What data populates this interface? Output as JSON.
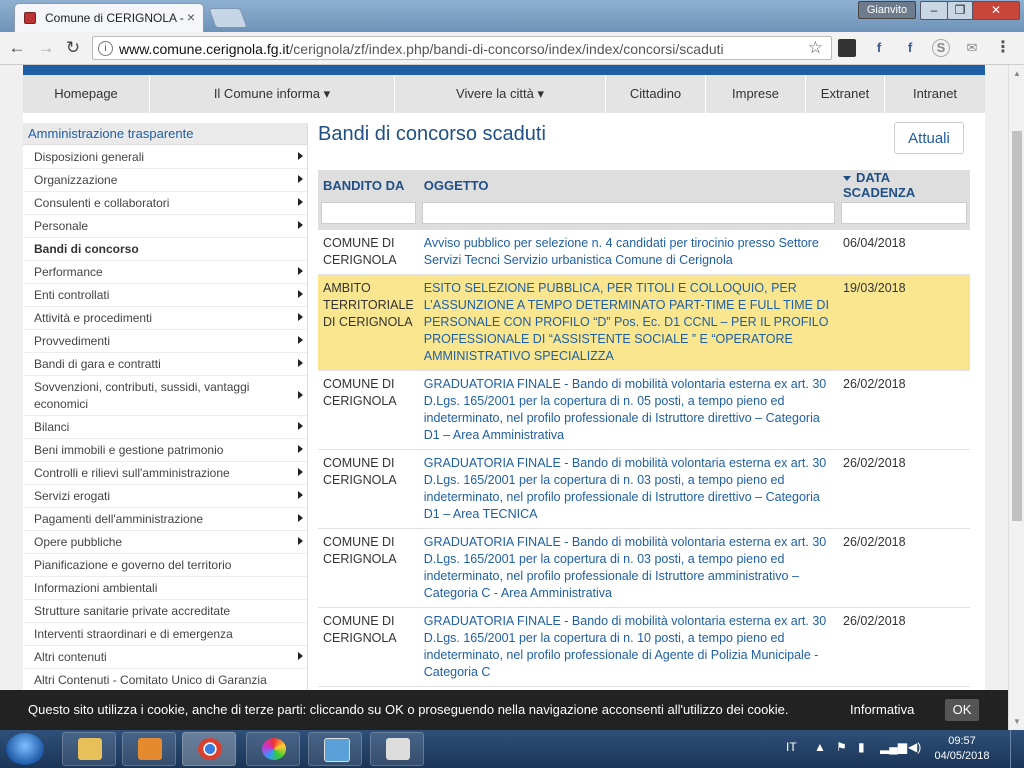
{
  "browser": {
    "tab_title": "Comune di CERIGNOLA -",
    "tab_close": "×",
    "user": "Gianvito",
    "url_host": "www.comune.cerignola.fg.it",
    "url_path": "/cerignola/zf/index.php/bandi-di-concorso/index/index/concorsi/scaduti",
    "back": "←",
    "forward": "→",
    "reload": "↻",
    "star": "☆",
    "win_min": "–",
    "win_max": "❐",
    "win_close": "✕",
    "ext_fb1": "f",
    "ext_fb2": "f",
    "ext_skype": "S"
  },
  "nav": [
    "Homepage",
    "Il Comune informa ▾",
    "Vivere la città ▾",
    "Cittadino",
    "Imprese",
    "Extranet",
    "Intranet"
  ],
  "sidebar": {
    "title": "Amministrazione trasparente",
    "items": [
      {
        "label": "Disposizioni generali",
        "arrow": true
      },
      {
        "label": "Organizzazione",
        "arrow": true
      },
      {
        "label": "Consulenti e collaboratori",
        "arrow": true
      },
      {
        "label": "Personale",
        "arrow": true
      },
      {
        "label": "Bandi di concorso",
        "arrow": false,
        "active": true
      },
      {
        "label": "Performance",
        "arrow": true
      },
      {
        "label": "Enti controllati",
        "arrow": true
      },
      {
        "label": "Attività e procedimenti",
        "arrow": true
      },
      {
        "label": "Provvedimenti",
        "arrow": true
      },
      {
        "label": "Bandi di gara e contratti",
        "arrow": true
      },
      {
        "label": "Sovvenzioni, contributi, sussidi, vantaggi economici",
        "arrow": true
      },
      {
        "label": "Bilanci",
        "arrow": true
      },
      {
        "label": "Beni immobili e gestione patrimonio",
        "arrow": true
      },
      {
        "label": "Controlli e rilievi sull'amministrazione",
        "arrow": true
      },
      {
        "label": "Servizi erogati",
        "arrow": true
      },
      {
        "label": "Pagamenti dell'amministrazione",
        "arrow": true
      },
      {
        "label": "Opere pubbliche",
        "arrow": true
      },
      {
        "label": "Pianificazione e governo del territorio",
        "arrow": false
      },
      {
        "label": "Informazioni ambientali",
        "arrow": false
      },
      {
        "label": "Strutture sanitarie private accreditate",
        "arrow": false
      },
      {
        "label": "Interventi straordinari e di emergenza",
        "arrow": false
      },
      {
        "label": "Altri contenuti",
        "arrow": true
      },
      {
        "label": "Altri Contenuti - Comitato Unico di Garanzia",
        "arrow": false
      }
    ]
  },
  "main": {
    "title": "Bandi di concorso scaduti",
    "attuali_button": "Attuali",
    "columns": {
      "bandito_da": "BANDITO DA",
      "oggetto": "OGGETTO",
      "data": "DATA SCADENZA"
    },
    "rows": [
      {
        "ente": "COMUNE DI CERIGNOLA",
        "oggetto": "Avviso pubblico per selezione n. 4 candidati per tirocinio presso Settore Servizi Tecnci Servizio urbanistica Comune di Cerignola",
        "data": "06/04/2018",
        "highlight": false
      },
      {
        "ente": "AMBITO TERRITORIALE DI CERIGNOLA",
        "oggetto": "ESITO SELEZIONE PUBBLICA, PER TITOLI E COLLOQUIO, PER L’ASSUNZIONE A TEMPO DETERMINATO PART-TIME E FULL TIME DI PERSONALE CON PROFILO “D” Pos. Ec. D1 CCNL – PER IL PROFILO PROFESSIONALE DI “ASSISTENTE SOCIALE ” E “OPERATORE AMMINISTRATIVO SPECIALIZZA",
        "data": "19/03/2018",
        "highlight": true
      },
      {
        "ente": "COMUNE DI CERIGNOLA",
        "oggetto": "GRADUATORIA FINALE - Bando di mobilità volontaria esterna ex art. 30 D.Lgs. 165/2001 per la copertura di n. 05 posti, a tempo pieno ed indeterminato, nel profilo professionale di Istruttore direttivo – Categoria D1 – Area Amministrativa",
        "data": "26/02/2018",
        "highlight": false
      },
      {
        "ente": "COMUNE DI CERIGNOLA",
        "oggetto": "GRADUATORIA FINALE - Bando di mobilità volontaria esterna ex art. 30 D.Lgs. 165/2001 per la copertura di n. 03 posti, a tempo pieno ed indeterminato, nel profilo professionale di Istruttore direttivo – Categoria D1 – Area TECNICA",
        "data": "26/02/2018",
        "highlight": false
      },
      {
        "ente": "COMUNE DI CERIGNOLA",
        "oggetto": "GRADUATORIA FINALE - Bando di mobilità volontaria esterna ex art. 30 D.Lgs. 165/2001 per la copertura di n. 03 posti, a tempo pieno ed indeterminato, nel profilo professionale di Istruttore amministrativo – Categoria C - Area Amministrativa",
        "data": "26/02/2018",
        "highlight": false
      },
      {
        "ente": "COMUNE DI CERIGNOLA",
        "oggetto": "GRADUATORIA FINALE - Bando di mobilità volontaria esterna ex art. 30 D.Lgs. 165/2001 per la copertura di n. 10 posti, a tempo pieno ed indeterminato, nel profilo professionale di Agente di Polizia Municipale - Categoria C",
        "data": "26/02/2018",
        "highlight": false
      }
    ]
  },
  "cookie": {
    "message": "Questo sito utilizza i cookie, anche di terze parti: cliccando su OK o proseguendo nella navigazione acconsenti all'utilizzo dei cookie.",
    "info_link": "Informativa",
    "ok": "OK"
  },
  "taskbar": {
    "lang": "IT",
    "time": "09:57",
    "date": "04/05/2018"
  },
  "colors": {
    "brand_blue": "#1f5fa6",
    "highlight": "#f9e68f",
    "cookie_bg": "#222222"
  }
}
